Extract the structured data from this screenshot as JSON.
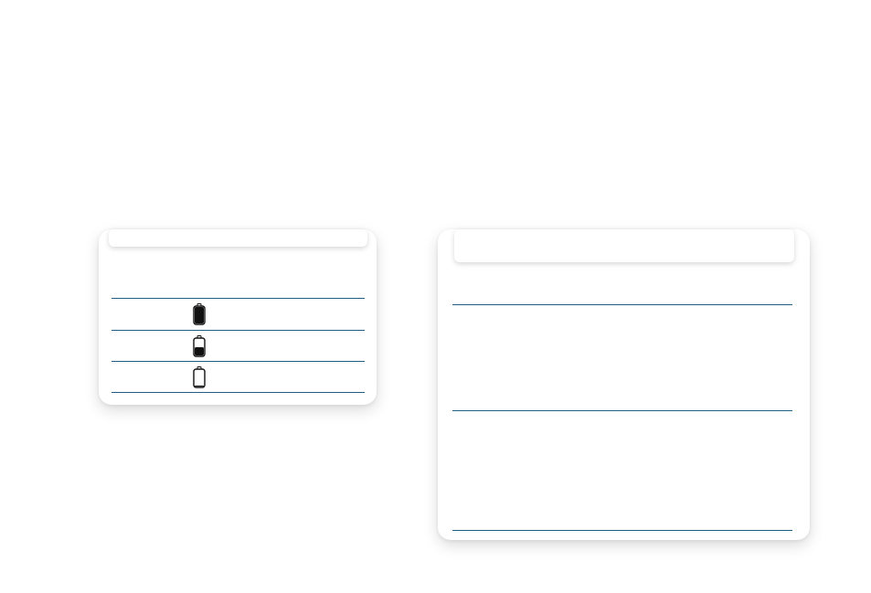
{
  "battery_card": {
    "title": "",
    "subtitle": "",
    "rows": [
      {
        "label": "",
        "icon": "battery-full-icon",
        "value": "",
        "level": 1.0
      },
      {
        "label": "",
        "icon": "battery-half-icon",
        "value": "",
        "level": 0.5
      },
      {
        "label": "",
        "icon": "battery-empty-icon",
        "value": "",
        "level": 0.0
      }
    ]
  },
  "detail_card": {
    "title": "",
    "sections": [
      {
        "text": ""
      },
      {
        "text": ""
      }
    ]
  },
  "colors": {
    "rule": "#1f5f86",
    "battery_fill": "#111111"
  }
}
